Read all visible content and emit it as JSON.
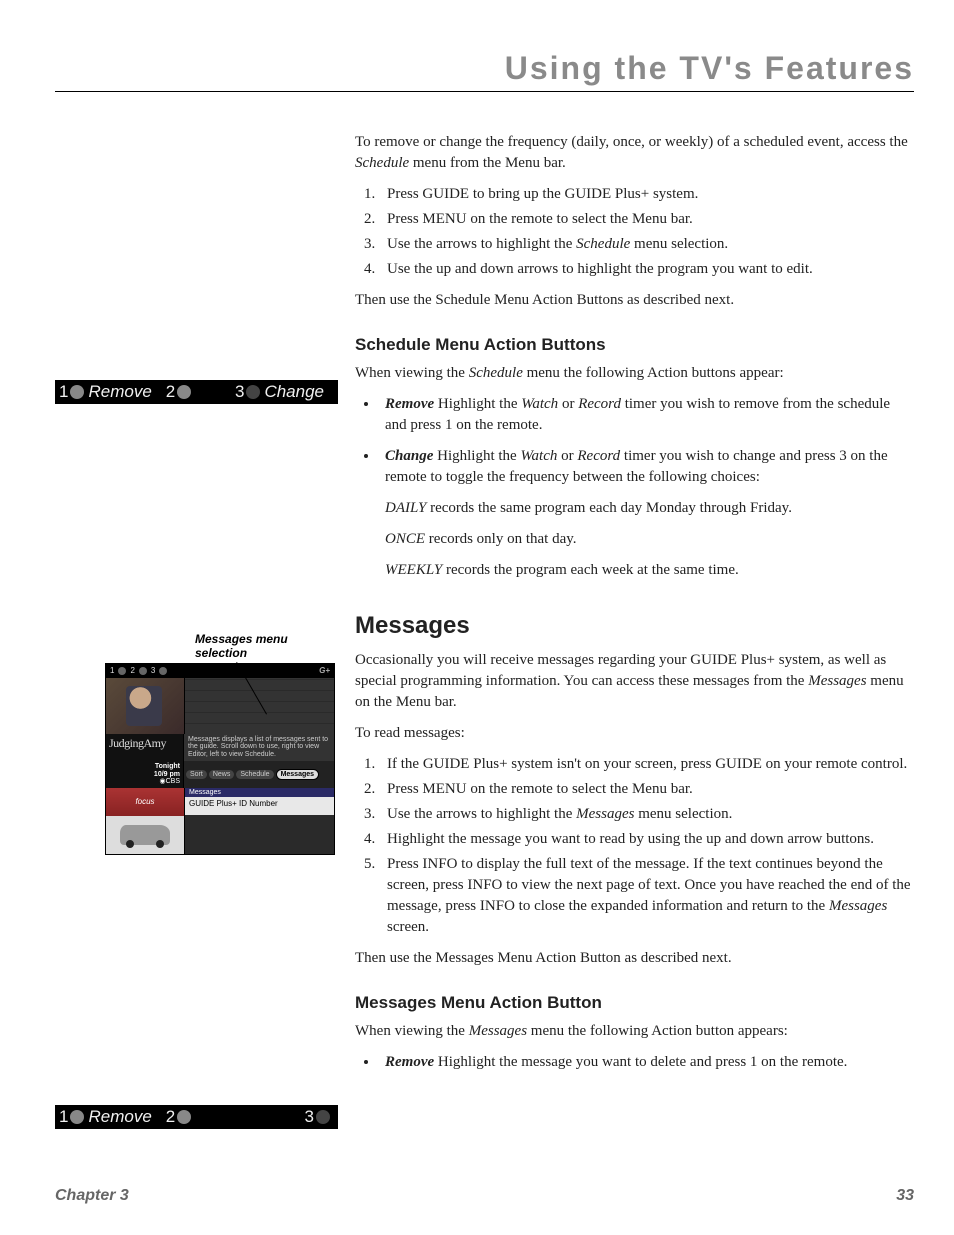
{
  "header": {
    "title": "Using the TV's Features"
  },
  "intro": {
    "p1a": "To remove or change the frequency (daily, once, or weekly) of a scheduled event, access the ",
    "p1_em": "Schedule",
    "p1b": " menu from the Menu bar."
  },
  "steps_intro": [
    "Press GUIDE to bring up the GUIDE Plus+ system.",
    "Press MENU on the remote to select the Menu bar.",
    "Use the arrows to highlight the Schedule menu selection.",
    "Use the up and down arrows to highlight the program you want to edit."
  ],
  "steps_intro_em": {
    "2": "Schedule"
  },
  "steps_intro_2_pre": "Use the arrows to highlight the ",
  "steps_intro_2_post": " menu selection.",
  "then1": "Then use the Schedule Menu Action Buttons as described next.",
  "sched_h": "Schedule Menu Action Buttons",
  "sched_p_pre": "When viewing the ",
  "sched_p_em": "Schedule",
  "sched_p_post": " menu the following Action buttons appear:",
  "sched_bullets": {
    "remove": {
      "term": "Remove",
      "text_pre": "    Highlight the ",
      "em1": "Watch",
      "mid": " or ",
      "em2": "Record",
      "text_post": " timer you wish to remove from the schedule and press 1 on the remote."
    },
    "change": {
      "term": "Change",
      "text_pre": "    Highlight the ",
      "em1": "Watch",
      "mid": " or ",
      "em2": "Record",
      "text_post": " timer you wish to change and press 3 on the remote to toggle the frequency between the following choices:"
    }
  },
  "freq": {
    "daily": {
      "term": "DAILY",
      "text": "   records the same program each day Monday through Friday."
    },
    "once": {
      "term": "ONCE",
      "text": "   records only on that day."
    },
    "weekly": {
      "term": "WEEKLY",
      "text": "   records the program each week at the same time."
    }
  },
  "msg_h": "Messages",
  "msg_p1_pre": "Occasionally you will receive messages regarding your GUIDE Plus+ system, as well as special programming information.  You can access these messages from the ",
  "msg_p1_em": "Messages",
  "msg_p1_post": " menu on the Menu bar.",
  "msg_read": "To read messages:",
  "msg_steps": [
    "If the GUIDE Plus+ system isn't on your screen, press GUIDE on your remote control.",
    "Press MENU on the remote to select the Menu bar.",
    "",
    "Highlight the message you want to read by using the up and down arrow buttons.",
    ""
  ],
  "msg_step3_pre": "Use the arrows to highlight the ",
  "msg_step3_em": "Messages",
  "msg_step3_post": " menu selection.",
  "msg_step5_pre": "Press INFO to display the full text of the message. If the text continues beyond the screen, press INFO to view the next page of text. Once you have reached the end of the message, press INFO to close the expanded information and return to the ",
  "msg_step5_em": "Messages",
  "msg_step5_post": " screen.",
  "then2": "Then use the Messages Menu Action Button as described next.",
  "msg_action_h": "Messages Menu Action Button",
  "msg_action_p_pre": "When viewing the ",
  "msg_action_p_em": "Messages",
  "msg_action_p_post": " menu the following Action button appears:",
  "msg_action_bullet": {
    "term": "Remove",
    "text": "    Highlight the message you want to delete and press 1 on the remote."
  },
  "actionbar1": {
    "n1": "1",
    "l1": "Remove",
    "n2": "2",
    "n3": "3",
    "l3": "Change"
  },
  "actionbar2": {
    "n1": "1",
    "l1": "Remove",
    "n2": "2",
    "n3": "3"
  },
  "fig": {
    "caption": "Messages menu selection",
    "desc": "Messages displays a list of messages sent to the guide. Scroll down to use, right to view Editor, left to view Schedule.",
    "show": "JudgingAmy",
    "time1": "Tonight",
    "time2": "10/9 pm",
    "net": "◉CBS",
    "tab_sort": "Sort",
    "tab_news": "News",
    "tab_sched": "Schedule",
    "tab_msg": "Messages",
    "msgbar": "Messages",
    "listitem": "GUIDE Plus+ ID Number",
    "ad": "focus",
    "logo": "G+",
    "bar_n1": "1",
    "bar_n2": "2",
    "bar_n3": "3"
  },
  "footer": {
    "chapter": "Chapter 3",
    "page": "33"
  }
}
